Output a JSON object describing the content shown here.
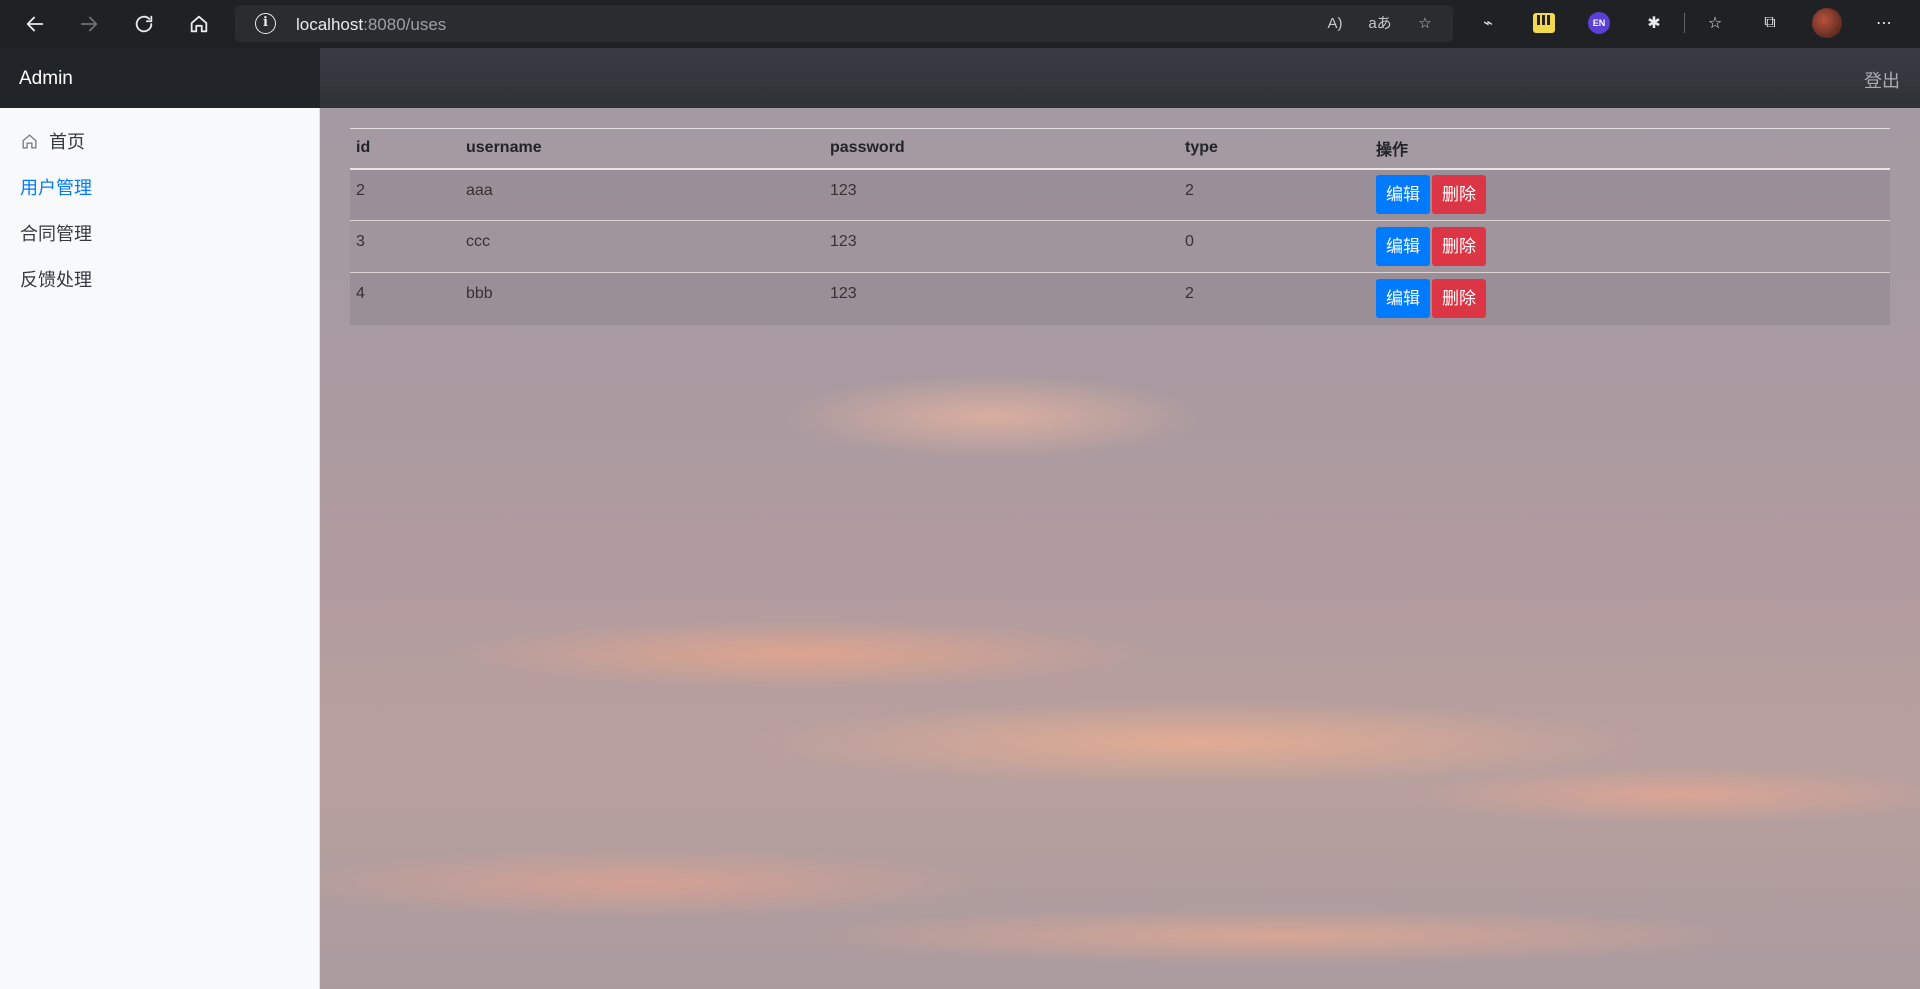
{
  "browser": {
    "url_host": "localhost",
    "url_path": ":8080/uses",
    "ext_en": "EN"
  },
  "app": {
    "brand": "Admin",
    "logout": "登出"
  },
  "sidebar": {
    "items": [
      {
        "label": "首页"
      },
      {
        "label": "用户管理"
      },
      {
        "label": "合同管理"
      },
      {
        "label": "反馈处理"
      }
    ]
  },
  "table": {
    "headers": [
      "id",
      "username",
      "password",
      "type",
      "操作"
    ],
    "rows": [
      {
        "id": "2",
        "username": "aaa",
        "password": "123",
        "type": "2"
      },
      {
        "id": "3",
        "username": "ccc",
        "password": "123",
        "type": "0"
      },
      {
        "id": "4",
        "username": "bbb",
        "password": "123",
        "type": "2"
      }
    ],
    "edit_label": "编辑",
    "delete_label": "删除"
  },
  "colors": {
    "primary": "#007bff",
    "danger": "#dc3545",
    "navbar": "#212529"
  }
}
